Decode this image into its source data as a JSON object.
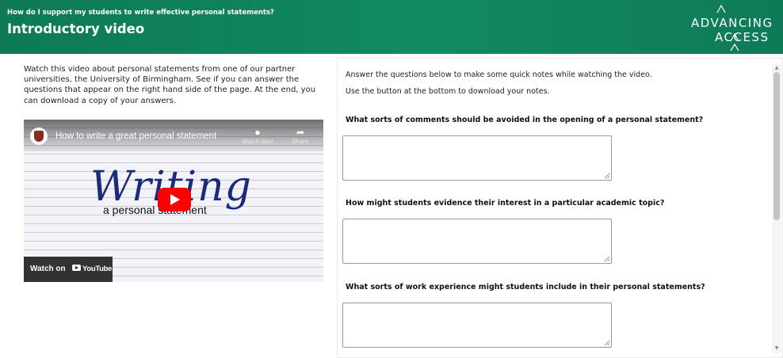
{
  "header": {
    "kicker": "How do I support my students to write effective personal statements?",
    "title": "Introductory video",
    "logo": {
      "line1": "ADVANCING",
      "line2": "ACCESS",
      "icon": "chevron-mountain-logo"
    }
  },
  "intro_text": "Watch this video about personal statements from one of our partner universities, the University of Birmingham. See if you can answer the questions that appear on the right hand side of the page. At the end, you can download a copy of your answers.",
  "video": {
    "title": "How to write a great personal statement",
    "watch_later_label": "Watch later",
    "share_label": "Share",
    "art_heading": "Writing",
    "art_subheading": "a personal statement",
    "watch_on_label": "Watch on",
    "youtube_label": "YouTube",
    "colors": {
      "play_button": "#ff0000",
      "art_heading": "#1c2a7a"
    }
  },
  "notes_panel": {
    "instruction_1": "Answer the questions below to make some quick notes while watching the video.",
    "instruction_2": "Use the button at the bottom to download your notes.",
    "questions": [
      {
        "label": "What sorts of comments should be avoided in the opening of a personal statement?",
        "answer": ""
      },
      {
        "label": "How might students evidence their interest in a particular academic topic?",
        "answer": ""
      },
      {
        "label": "What sorts of work experience might students include in their personal statements?",
        "answer": ""
      }
    ]
  },
  "colors": {
    "header_green": "#128a5f",
    "text": "#222222"
  }
}
